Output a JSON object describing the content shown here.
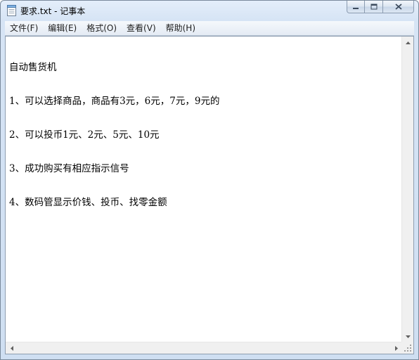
{
  "window": {
    "title": "要求.txt - 记事本",
    "icons": {
      "app": "notepad-icon",
      "minimize": "minimize-icon",
      "maximize": "maximize-icon",
      "close": "close-icon"
    }
  },
  "menu": [
    {
      "label": "文件(F)"
    },
    {
      "label": "编辑(E)"
    },
    {
      "label": "格式(O)"
    },
    {
      "label": "查看(V)"
    },
    {
      "label": "帮助(H)"
    }
  ],
  "document": {
    "lines": [
      "自动售货机",
      "1、可以选择商品，商品有3元，6元，7元，9元的",
      "2、可以投币1元、2元、5元、10元",
      "3、成功购买有相应指示信号",
      "4、数码管显示价钱、投币、找零金额"
    ]
  },
  "scrollbars": {
    "icons": {
      "up": "scroll-up-arrow-icon",
      "down": "scroll-down-arrow-icon",
      "left": "scroll-left-arrow-icon",
      "right": "scroll-right-arrow-icon",
      "grip": "resize-grip-icon"
    }
  },
  "colors": {
    "frame": "#d6e4f5",
    "close_hover": "#c75050",
    "text": "#000000"
  }
}
